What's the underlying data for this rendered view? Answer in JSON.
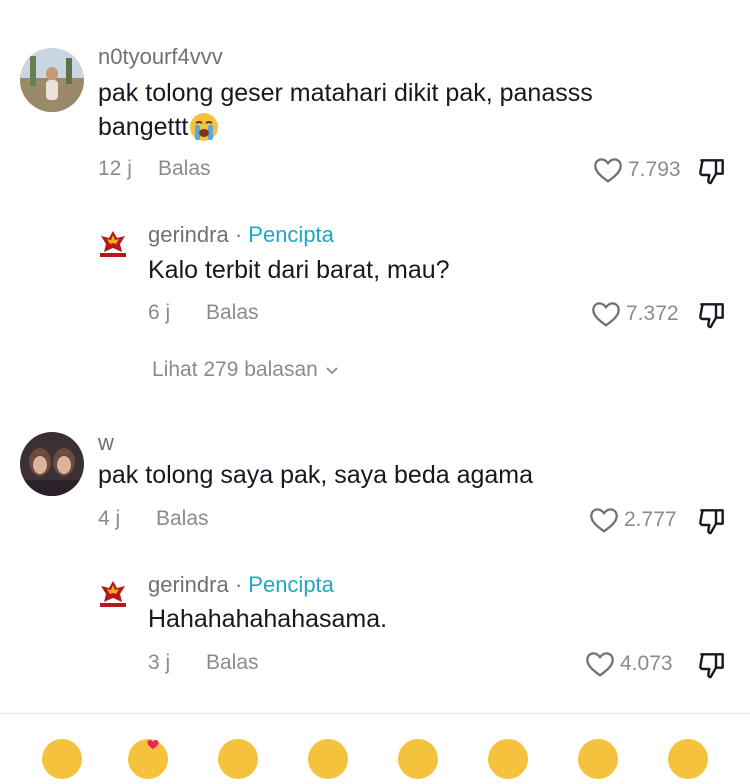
{
  "comments": [
    {
      "username": "n0tyourf4vvv",
      "text_line1": "pak tolong geser matahari dikit pak, panasss",
      "text_line2": "bangettt",
      "time": "12 j",
      "reply_label": "Balas",
      "likes": "7.793",
      "reply": {
        "username": "gerindra",
        "creator_label": "Pencipta",
        "text": "Kalo terbit dari barat, mau?",
        "time": "6 j",
        "reply_label": "Balas",
        "likes": "7.372"
      },
      "view_replies": "Lihat 279 balasan"
    },
    {
      "username": "w",
      "text_line1": "pak tolong saya pak, saya beda agama",
      "time": "4 j",
      "reply_label": "Balas",
      "likes": "2.777",
      "reply": {
        "username": "gerindra",
        "creator_label": "Pencipta",
        "text": "Hahahahahahasama.",
        "time": "3 j",
        "reply_label": "Balas",
        "likes": "4.073"
      }
    }
  ],
  "emoji_bar": [
    "emoji-grin",
    "emoji-heart-eyes",
    "emoji-laugh",
    "emoji-wink",
    "emoji-smile",
    "emoji-surprise",
    "emoji-cry",
    "emoji-thumbs"
  ],
  "colors": {
    "creator_accent": "#20a8c2",
    "meta_gray": "#8a8b91",
    "emoji_yellow": "#f4c23c"
  }
}
